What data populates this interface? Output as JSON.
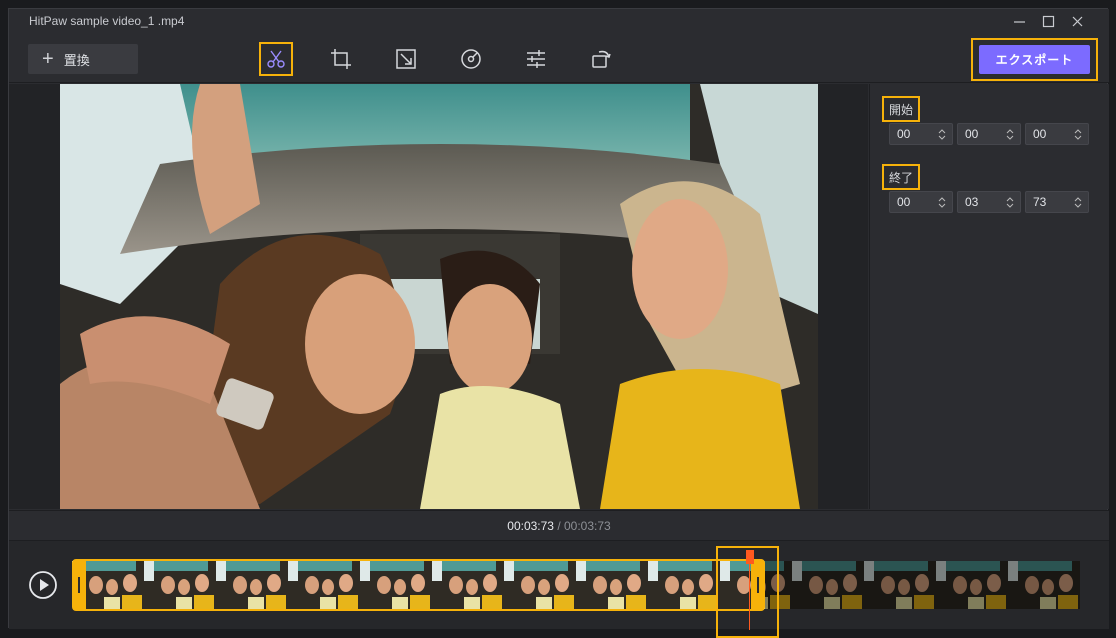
{
  "window": {
    "title": "HitPaw sample video_1 .mp4",
    "controls": [
      "minimize-icon",
      "maximize-icon",
      "close-icon"
    ]
  },
  "toolbar": {
    "replace_label": "置換",
    "tools": [
      {
        "name": "cut-icon",
        "active": true
      },
      {
        "name": "crop-icon",
        "active": false
      },
      {
        "name": "resize-icon",
        "active": false
      },
      {
        "name": "speed-icon",
        "active": false
      },
      {
        "name": "adjust-icon",
        "active": false
      },
      {
        "name": "rotate-icon",
        "active": false
      }
    ],
    "export_label": "エクスポート"
  },
  "trim": {
    "start_label": "開始",
    "start": [
      "00",
      "00",
      "00"
    ],
    "end_label": "終了",
    "end": [
      "00",
      "03",
      "73"
    ]
  },
  "playback": {
    "current": "00:03:73",
    "separator": " / ",
    "total": "00:03:73"
  },
  "colors": {
    "accent": "#7c6bff",
    "highlight": "#f6b20a",
    "playhead": "#ff5a1f",
    "background": "#2b2c30"
  }
}
